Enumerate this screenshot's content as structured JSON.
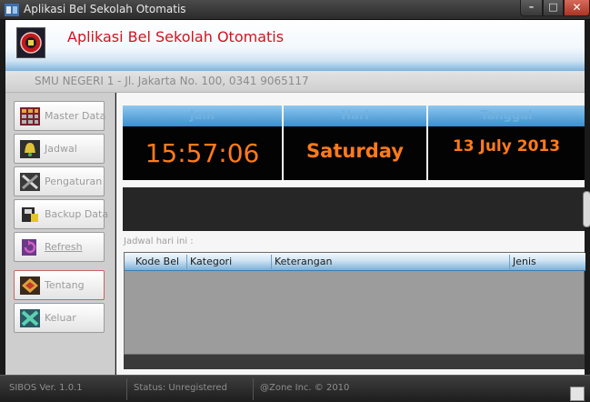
{
  "window": {
    "title": "Aplikasi Bel Sekolah Otomatis",
    "minimize_glyph": "–",
    "maximize_glyph": "□",
    "close_glyph": "✕"
  },
  "header": {
    "app_title": "Aplikasi Bel Sekolah Otomatis",
    "school_info": "SMU NEGERI 1  -  Jl. Jakarta No. 100, 0341 9065117"
  },
  "sidebar": {
    "items": [
      {
        "label": "Master Data",
        "icon": "grid-icon"
      },
      {
        "label": "Jadwal",
        "icon": "bell-icon"
      },
      {
        "label": "Pengaturan",
        "icon": "tools-icon"
      },
      {
        "label": "Backup Data",
        "icon": "backup-icon"
      },
      {
        "label": "Refresh",
        "icon": "refresh-icon"
      },
      {
        "label": "Tentang",
        "icon": "about-icon"
      },
      {
        "label": "Keluar",
        "icon": "exit-icon"
      }
    ]
  },
  "clock": {
    "jam_label": "Jam",
    "hari_label": "Hari",
    "tanggal_label": "Tanggal",
    "time": "15:57:06",
    "day": "Saturday",
    "date": "13 July 2013"
  },
  "schedule": {
    "label": "Jadwal hari ini :",
    "columns": [
      "Kode Bel",
      "Kategori",
      "Keterangan",
      "Jenis"
    ],
    "rows": []
  },
  "status": {
    "version": "SIBOS Ver. 1.0.1",
    "registration": "Status: Unregistered",
    "copyright": "@Zone Inc. © 2010"
  },
  "colors": {
    "accent_blue": "#3a8fcf",
    "title_red": "#d1141f",
    "clock_orange": "#ff7a1a"
  }
}
